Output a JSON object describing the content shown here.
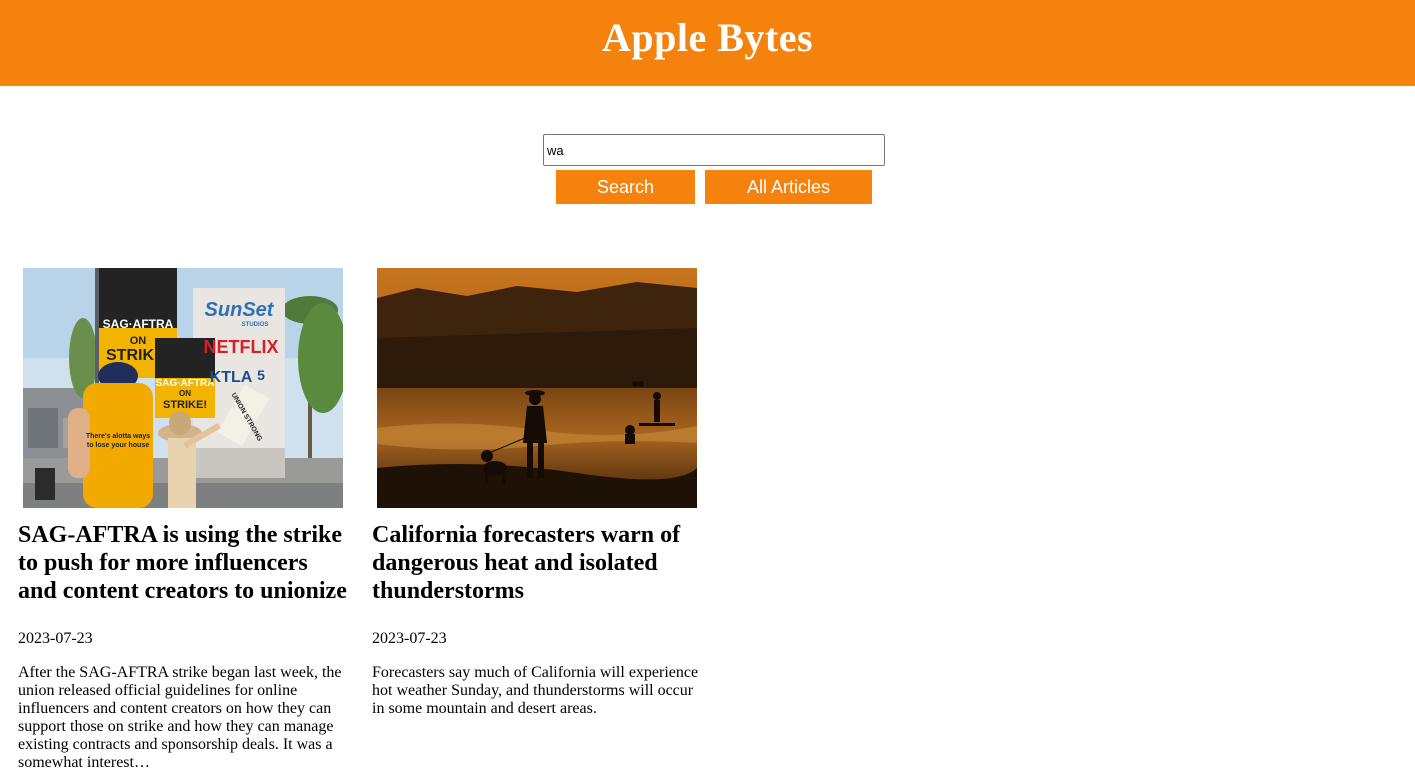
{
  "header": {
    "title": "Apple Bytes"
  },
  "search": {
    "value": "wa",
    "search_label": "Search",
    "all_label": "All Articles"
  },
  "articles": [
    {
      "title": "SAG-AFTRA is using the strike to push for more influencers and content creators to unionize",
      "date": "2023-07-23",
      "excerpt": "After the SAG-AFTRA strike began last week, the union released official guidelines for online influencers and content creators on how they can support those on strike and how they can manage existing contracts and sponsorship deals. It was a somewhat interest…",
      "image_signs": {
        "sign1_top": "SAG·AFTRA",
        "sign1_on": "ON",
        "sign1_strike": "STRIKE!",
        "sign2_top": "SAG·AFTRA",
        "sign2_on": "ON",
        "sign2_strike": "STRIKE!",
        "sunset": "SunSet",
        "studios": "STUDIOS",
        "netflix": "NETFLIX",
        "ktla": "KTLA",
        "ktla_num": "5",
        "shirt_1": "There's alotta ways",
        "shirt_2": "to lose your house",
        "hand_sign": "UNION STRONG"
      }
    },
    {
      "title": "California forecasters warn of dangerous heat and isolated thunderstorms",
      "date": "2023-07-23",
      "excerpt": "Forecasters say much of California will experience hot weather Sunday, and thunderstorms will occur in some mountain and desert areas."
    }
  ],
  "colors": {
    "accent": "#f5820d"
  }
}
